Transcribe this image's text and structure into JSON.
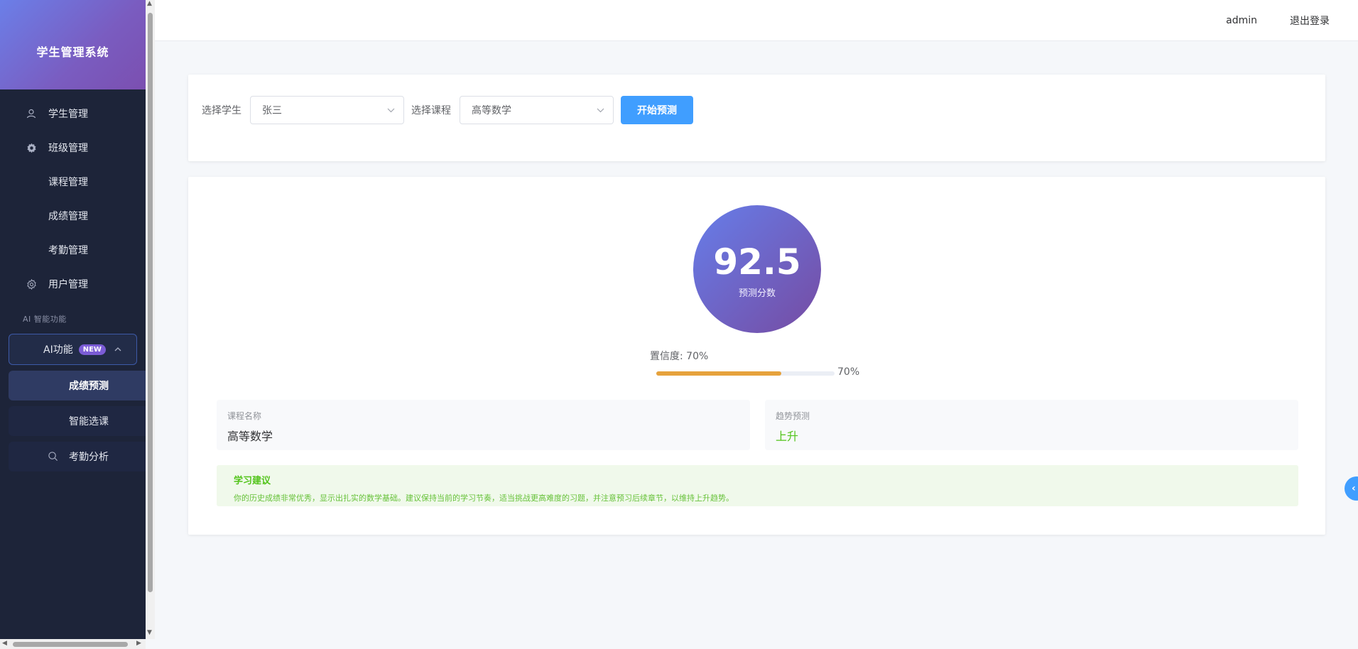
{
  "app": {
    "title": "学生管理系统"
  },
  "sidebar": {
    "items": [
      {
        "label": "学生管理",
        "icon": "user-icon"
      },
      {
        "label": "班级管理",
        "icon": "gear-icon"
      },
      {
        "label": "课程管理"
      },
      {
        "label": "成绩管理"
      },
      {
        "label": "考勤管理"
      },
      {
        "label": "用户管理",
        "icon": "settings-icon"
      }
    ],
    "group_title": "AI 智能功能",
    "ai_menu": {
      "label": "AI功能",
      "badge": "NEW",
      "children": [
        {
          "label": "成绩预测",
          "active": true
        },
        {
          "label": "智能选课"
        },
        {
          "label": "考勤分析",
          "icon": "search-icon"
        }
      ]
    }
  },
  "header": {
    "user": "admin",
    "logout": "退出登录"
  },
  "form": {
    "student_label": "选择学生",
    "student_value": "张三",
    "course_label": "选择课程",
    "course_value": "高等数学",
    "submit_label": "开始预测"
  },
  "result": {
    "score": "92.5",
    "score_label": "预测分数",
    "confidence_label": "置信度: 70%",
    "confidence_percent": 70,
    "progress_text": "70%",
    "course_key": "课程名称",
    "course_value": "高等数学",
    "trend_key": "趋势预测",
    "trend_value": "上升",
    "advice_title": "学习建议",
    "advice_text": "你的历史成绩非常优秀，显示出扎实的数学基础。建议保持当前的学习节奏，适当挑战更高难度的习题，并注意预习后续章节，以维持上升趋势。"
  },
  "colors": {
    "primary": "#409eff",
    "progress": "#e6a23c",
    "success": "#52c41a",
    "sidebar_bg": "#1d2439"
  }
}
